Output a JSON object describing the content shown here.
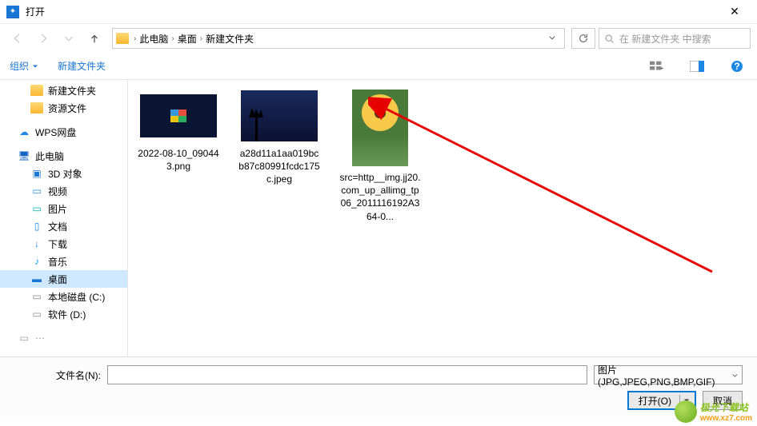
{
  "window": {
    "title": "打开"
  },
  "breadcrumb": {
    "items": [
      "此电脑",
      "桌面",
      "新建文件夹"
    ]
  },
  "search": {
    "placeholder": "在 新建文件夹 中搜索"
  },
  "toolbar": {
    "organize": "组织",
    "new_folder": "新建文件夹"
  },
  "sidebar": {
    "items": [
      {
        "label": "新建文件夹",
        "icon": "folder",
        "sub": true
      },
      {
        "label": "资源文件",
        "icon": "folder",
        "sub": true
      },
      {
        "label": "WPS网盘",
        "icon": "wps",
        "sub": false
      },
      {
        "label": "此电脑",
        "icon": "pc",
        "sub": false
      },
      {
        "label": "3D 对象",
        "icon": "3d",
        "sub": true
      },
      {
        "label": "视频",
        "icon": "video",
        "sub": true
      },
      {
        "label": "图片",
        "icon": "pic",
        "sub": true
      },
      {
        "label": "文档",
        "icon": "doc",
        "sub": true
      },
      {
        "label": "下载",
        "icon": "dl",
        "sub": true
      },
      {
        "label": "音乐",
        "icon": "music",
        "sub": true
      },
      {
        "label": "桌面",
        "icon": "desktop",
        "sub": true,
        "selected": true
      },
      {
        "label": "本地磁盘 (C:)",
        "icon": "drive",
        "sub": true
      },
      {
        "label": "软件 (D:)",
        "icon": "drive",
        "sub": true
      }
    ]
  },
  "files": [
    {
      "name": "2022-08-10_090443.png",
      "thumb": "windows"
    },
    {
      "name": "a28d11a1aa019bcb87c80991fcdc175c.jpeg",
      "thumb": "tree"
    },
    {
      "name": "src=http__img.jj20.com_up_allimg_tp06_2011116192A364-0...",
      "thumb": "sunflower"
    }
  ],
  "footer": {
    "filename_label": "文件名(N):",
    "filename_value": "",
    "filter": "图片(JPG,JPEG,PNG,BMP,GIF)",
    "open": "打开(O)",
    "cancel": "取消"
  },
  "watermark": {
    "text": "极光下载站",
    "url": "www.xz7.com"
  }
}
